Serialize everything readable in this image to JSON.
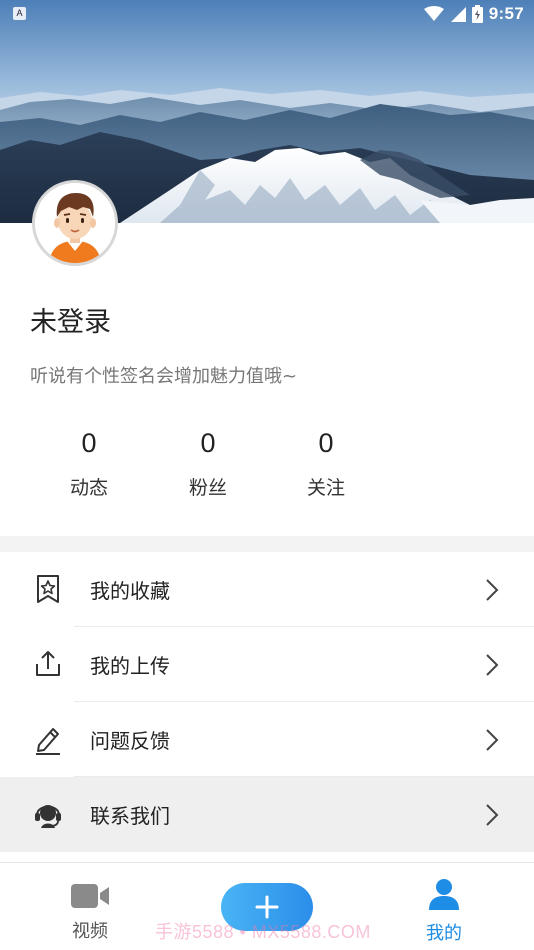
{
  "status_bar": {
    "app_badge": "A",
    "time": "9:57",
    "icons": [
      "wifi-icon",
      "signal-icon",
      "battery-icon"
    ]
  },
  "banner": {
    "image": "snowy-mountain-landscape"
  },
  "profile": {
    "avatar": "cartoon-boy-avatar",
    "name": "未登录",
    "signature": "听说有个性签名会增加魅力值哦~",
    "stats": [
      {
        "value": "0",
        "label": "动态"
      },
      {
        "value": "0",
        "label": "粉丝"
      },
      {
        "value": "0",
        "label": "关注"
      }
    ]
  },
  "menu": {
    "items": [
      {
        "label": "我的收藏",
        "icon": "star-bookmark-icon"
      },
      {
        "label": "我的上传",
        "icon": "upload-icon"
      },
      {
        "label": "问题反馈",
        "icon": "edit-pencil-icon"
      },
      {
        "label": "联系我们",
        "icon": "headset-support-icon"
      }
    ]
  },
  "bottom_nav": {
    "video_label": "视频",
    "add_icon": "plus-icon",
    "mine_label": "我的"
  },
  "watermark": "手游5588 • MX5588.COM",
  "colors": {
    "accent": "#1e8de6",
    "fab_start": "#49b4f5",
    "fab_end": "#2b8ee9"
  }
}
